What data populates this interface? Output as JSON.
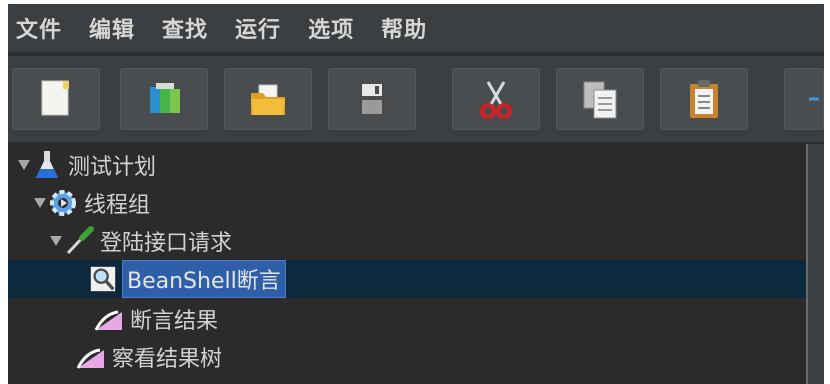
{
  "menubar": {
    "items": [
      "文件",
      "编辑",
      "查找",
      "运行",
      "选项",
      "帮助"
    ]
  },
  "toolbar": {
    "buttons": [
      {
        "name": "new",
        "icon": "new-document-icon"
      },
      {
        "name": "templates",
        "icon": "templates-icon"
      },
      {
        "name": "open",
        "icon": "open-folder-icon"
      },
      {
        "name": "save",
        "icon": "save-disk-icon"
      },
      {
        "name": "cut",
        "icon": "scissors-icon"
      },
      {
        "name": "copy",
        "icon": "copy-icon"
      },
      {
        "name": "paste",
        "icon": "clipboard-icon"
      }
    ]
  },
  "tree": {
    "nodes": [
      {
        "label": "测试计划",
        "icon": "flask-icon",
        "expanded": true
      },
      {
        "label": "线程组",
        "icon": "gear-icon",
        "expanded": true
      },
      {
        "label": "登陆接口请求",
        "icon": "pipette-icon",
        "expanded": true
      },
      {
        "label": "BeanShell断言",
        "icon": "magnifier-icon",
        "selected": true
      },
      {
        "label": "断言结果",
        "icon": "chart-icon"
      },
      {
        "label": "察看结果树",
        "icon": "chart-icon"
      }
    ]
  },
  "colors": {
    "background": "#3c3f41",
    "tree_background": "#2b2b2b",
    "selection_row": "#0d293e",
    "selection_label": "#2e5fa8",
    "text": "#d2d2d2"
  }
}
